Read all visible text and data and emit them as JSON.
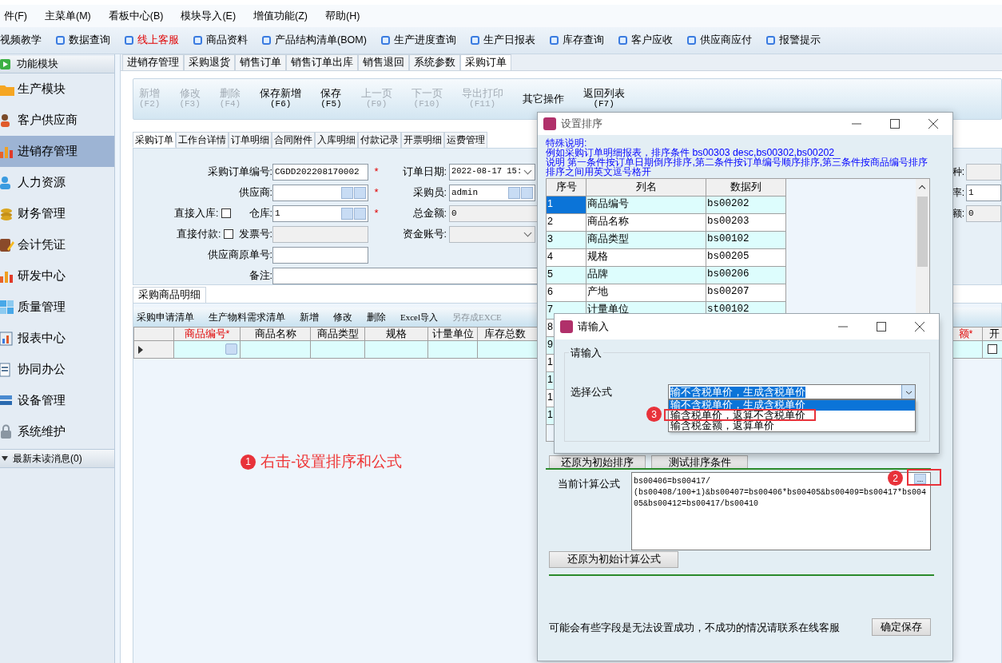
{
  "menu": [
    {
      "label": "件(F)"
    },
    {
      "label": "主菜单(M)"
    },
    {
      "label": "看板中心(B)"
    },
    {
      "label": "模块导入(E)"
    },
    {
      "label": "增值功能(Z)"
    },
    {
      "label": "帮助(H)"
    }
  ],
  "quick_links": [
    {
      "label": "视频教学",
      "icon": false,
      "highlighted": false
    },
    {
      "label": "数据查询",
      "icon": true,
      "highlighted": false
    },
    {
      "label": "线上客服",
      "icon": true,
      "highlighted": true
    },
    {
      "label": "商品资料",
      "icon": true,
      "highlighted": false
    },
    {
      "label": "产品结构清单(BOM)",
      "icon": true,
      "highlighted": false
    },
    {
      "label": "生产进度查询",
      "icon": true,
      "highlighted": false
    },
    {
      "label": "生产日报表",
      "icon": true,
      "highlighted": false
    },
    {
      "label": "库存查询",
      "icon": true,
      "highlighted": false
    },
    {
      "label": "客户应收",
      "icon": true,
      "highlighted": false
    },
    {
      "label": "供应商应付",
      "icon": true,
      "highlighted": false
    },
    {
      "label": "报警提示",
      "icon": true,
      "highlighted": false
    }
  ],
  "sidebar": {
    "title": "功能模块",
    "items": [
      {
        "label": "生产模块",
        "selected": false
      },
      {
        "label": "客户供应商",
        "selected": false
      },
      {
        "label": "进销存管理",
        "selected": true
      },
      {
        "label": "人力资源",
        "selected": false
      },
      {
        "label": "财务管理",
        "selected": false
      },
      {
        "label": "会计凭证",
        "selected": false
      },
      {
        "label": "研发中心",
        "selected": false
      },
      {
        "label": "质量管理",
        "selected": false
      },
      {
        "label": "报表中心",
        "selected": false
      },
      {
        "label": "协同办公",
        "selected": false
      },
      {
        "label": "设备管理",
        "selected": false
      },
      {
        "label": "系统维护",
        "selected": false
      }
    ],
    "footer": "最新未读消息(0)"
  },
  "tabs": [
    {
      "label": "进销存管理",
      "selected": false
    },
    {
      "label": "采购退货",
      "selected": false
    },
    {
      "label": "销售订单",
      "selected": false
    },
    {
      "label": "销售订单出库",
      "selected": false
    },
    {
      "label": "销售退回",
      "selected": false
    },
    {
      "label": "系统参数",
      "selected": false
    },
    {
      "label": "采购订单",
      "selected": true
    }
  ],
  "toolbar": [
    {
      "label": "新增",
      "key": "(F2)",
      "disabled": true
    },
    {
      "label": "修改",
      "key": "(F3)",
      "disabled": true
    },
    {
      "label": "删除",
      "key": "(F4)",
      "disabled": true
    },
    {
      "label": "保存新增",
      "key": "(F6)",
      "disabled": false
    },
    {
      "label": "保存",
      "key": "(F5)",
      "disabled": false
    },
    {
      "label": "上一页",
      "key": "(F9)",
      "disabled": true
    },
    {
      "label": "下一页",
      "key": "(F10)",
      "disabled": true
    },
    {
      "label": "导出打印",
      "key": "(F11)",
      "disabled": true
    },
    {
      "label": "其它操作",
      "disabled": false
    },
    {
      "label": "返回列表",
      "key": "(F7)",
      "disabled": false
    }
  ],
  "subtabs": [
    {
      "label": "采购订单",
      "selected": true
    },
    {
      "label": "工作台详情",
      "selected": false
    },
    {
      "label": "订单明细",
      "selected": false
    },
    {
      "label": "合同附件",
      "selected": false
    },
    {
      "label": "入库明细",
      "selected": false
    },
    {
      "label": "付款记录",
      "selected": false
    },
    {
      "label": "开票明细",
      "selected": false
    },
    {
      "label": "运费管理",
      "selected": false
    }
  ],
  "form": {
    "order_no": {
      "label": "采购订单编号:",
      "value": "CGDD202208170002",
      "required_mark": "*"
    },
    "order_date": {
      "label": "订单日期:",
      "value": "2022-08-17 15:"
    },
    "supplier": {
      "label": "供应商:",
      "required_mark": "*"
    },
    "buyer": {
      "label": "采购员:",
      "value": "admin"
    },
    "direct_in": {
      "label": "直接入库:",
      "checked": false
    },
    "warehouse": {
      "label": "仓库:",
      "value": "1",
      "required_mark": "*"
    },
    "total": {
      "label": "总金额:",
      "value": "0"
    },
    "direct_pay": {
      "label": "直接付款:",
      "checked": false
    },
    "invoice_no": {
      "label": "发票号:",
      "disabled": true
    },
    "fund_account": {
      "label": "资金账号:",
      "disabled": true
    },
    "supplier_ref": {
      "label": "供应商原单号:"
    },
    "remark": {
      "label": "备注:"
    },
    "right_fields": [
      {
        "label": "种:",
        "disabled": true
      },
      {
        "label": "率:",
        "value": "1",
        "disabled": false
      },
      {
        "label": "额:",
        "value": "0",
        "disabled": true
      }
    ]
  },
  "detail_tab": "采购商品明细",
  "grid_toolbar": [
    {
      "label": "采购申请清单",
      "disabled": false
    },
    {
      "label": "生产物料需求清单",
      "disabled": false
    },
    {
      "label": "新增",
      "disabled": false
    },
    {
      "label": "修改",
      "disabled": false
    },
    {
      "label": "删除",
      "disabled": false
    },
    {
      "label": "Excel导入",
      "disabled": false
    },
    {
      "label": "另存成EXCE",
      "disabled": true
    }
  ],
  "grid": {
    "columns": [
      {
        "label": "商品编号*",
        "required": true
      },
      {
        "label": "商品名称",
        "required": false
      },
      {
        "label": "商品类型",
        "required": false
      },
      {
        "label": "规格",
        "required": false
      },
      {
        "label": "计量单位",
        "required": false
      },
      {
        "label": "库存总数",
        "required": false
      }
    ],
    "right_columns": [
      {
        "label": "额*",
        "required": true
      },
      {
        "label": "开",
        "required": false
      }
    ],
    "rows": [
      {
        "checked": false
      }
    ]
  },
  "annotation": {
    "number": "1",
    "text": "右击-设置排序和公式"
  },
  "sort_dialog": {
    "title": "设置排序",
    "notes": [
      "特殊说明:",
      "例如采购订单明细报表，排序条件 bs00303 desc,bs00302,bs00202",
      "说明 第一条件按订单日期倒序排序,第二条件按订单编号顺序排序,第三条件按商品编号排序",
      "排序之间用英文逗号格开"
    ],
    "columns": [
      "序号",
      "列名",
      "数据列"
    ],
    "rows": [
      {
        "seq": "1",
        "name": "商品编号",
        "field": "bs00202",
        "selected": true
      },
      {
        "seq": "2",
        "name": "商品名称",
        "field": "bs00203",
        "selected": false
      },
      {
        "seq": "3",
        "name": "商品类型",
        "field": "bs00102",
        "selected": false
      },
      {
        "seq": "4",
        "name": "规格",
        "field": "bs00205",
        "selected": false
      },
      {
        "seq": "5",
        "name": "品牌",
        "field": "bs00206",
        "selected": false
      },
      {
        "seq": "6",
        "name": "产地",
        "field": "bs00207",
        "selected": false
      },
      {
        "seq": "7",
        "name": "计量单位",
        "field": "st00102",
        "selected": false
      },
      {
        "seq": "8",
        "selected": false
      },
      {
        "seq": "9",
        "selected": false
      },
      {
        "seq": "1",
        "selected": false
      },
      {
        "seq": "1",
        "selected": false
      },
      {
        "seq": "1",
        "selected": false
      },
      {
        "seq": "1",
        "selected": false
      }
    ],
    "buttons": [
      "还原为初始排序",
      "测试排序条件"
    ],
    "formula_label": "当前计算公式",
    "formula_lines": [
      "bs00406=bs00417/",
      "(bs00408/100+1)&bs00407=bs00406*bs00405&bs00409=bs00417*bs004",
      "05&bs00412=bs00417/bs00410"
    ],
    "formula_button": "...",
    "marker": "2",
    "reset_formula_button": "还原为初始计算公式",
    "footer_note": "可能会有些字段是无法设置成功，不成功的情况请联系在线客服",
    "save_button": "确定保存"
  },
  "input_dialog": {
    "title": "请输入",
    "group": "请输入",
    "label": "选择公式",
    "value": "输不含税单价，生成含税单价",
    "options": [
      {
        "label": "输不含税单价，生成含税单价",
        "selected": true,
        "marked": false
      },
      {
        "label": "输含税单价，返算不含税单价",
        "selected": false,
        "marked": true
      },
      {
        "label": "输含税金额，返算单价",
        "selected": false,
        "marked": false
      }
    ],
    "marker": "3"
  }
}
